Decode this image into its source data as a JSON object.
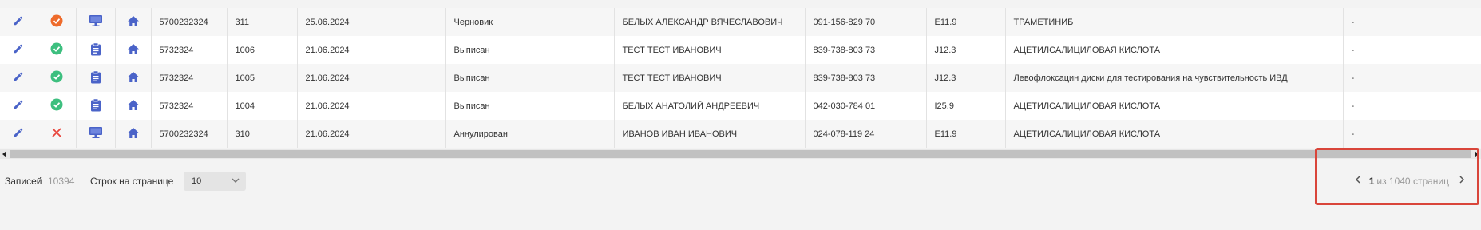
{
  "table": {
    "rows": [
      {
        "status": "draft",
        "source": "monitor",
        "id": "5700232324",
        "num": "311",
        "date": "25.06.2024",
        "state": "Черновик",
        "patient": "БЕЛЫХ АЛЕКСАНДР ВЯЧЕСЛАВОВИЧ",
        "snils": "091-156-829 70",
        "diagnosis": "E11.9",
        "drug": "ТРАМЕТИНИБ",
        "extra": "-"
      },
      {
        "status": "issued",
        "source": "clipboard",
        "id": "5732324",
        "num": "1006",
        "date": "21.06.2024",
        "state": "Выписан",
        "patient": "ТЕСТ ТЕСТ ИВАНОВИЧ",
        "snils": "839-738-803 73",
        "diagnosis": "J12.3",
        "drug": "АЦЕТИЛСАЛИЦИЛОВАЯ КИСЛОТА",
        "extra": "-"
      },
      {
        "status": "issued",
        "source": "clipboard",
        "id": "5732324",
        "num": "1005",
        "date": "21.06.2024",
        "state": "Выписан",
        "patient": "ТЕСТ ТЕСТ ИВАНОВИЧ",
        "snils": "839-738-803 73",
        "diagnosis": "J12.3",
        "drug": "Левофлоксацин диски для тестирования на чувствительность ИВД",
        "extra": "-"
      },
      {
        "status": "issued",
        "source": "clipboard",
        "id": "5732324",
        "num": "1004",
        "date": "21.06.2024",
        "state": "Выписан",
        "patient": "БЕЛЫХ АНАТОЛИЙ АНДРЕЕВИЧ",
        "snils": "042-030-784 01",
        "diagnosis": "I25.9",
        "drug": "АЦЕТИЛСАЛИЦИЛОВАЯ КИСЛОТА",
        "extra": "-"
      },
      {
        "status": "cancelled",
        "source": "monitor",
        "id": "5700232324",
        "num": "310",
        "date": "21.06.2024",
        "state": "Аннулирован",
        "patient": "ИВАНОВ ИВАН ИВАНОВИЧ",
        "snils": "024-078-119 24",
        "diagnosis": "E11.9",
        "drug": "АЦЕТИЛСАЛИЦИЛОВАЯ КИСЛОТА",
        "extra": "-"
      }
    ]
  },
  "footer": {
    "records_label": "Записей",
    "records_count": "10394",
    "rows_per_page_label": "Строк на странице",
    "rows_per_page_value": "10",
    "current_page": "1",
    "pages_text": "из 1040 страниц"
  },
  "icons": {
    "edit": "pencil-icon",
    "status_draft": "orange-check-circle-icon",
    "status_issued": "green-check-circle-icon",
    "status_cancelled": "red-x-icon",
    "source_monitor": "monitor-icon",
    "source_clipboard": "clipboard-icon",
    "home": "home-icon"
  },
  "colors": {
    "icon_blue": "#4a63c8",
    "draft_orange": "#ee6b2b",
    "issued_green": "#3dbf7f",
    "cancelled_red": "#e8453c",
    "highlight_red": "#d9453a"
  }
}
